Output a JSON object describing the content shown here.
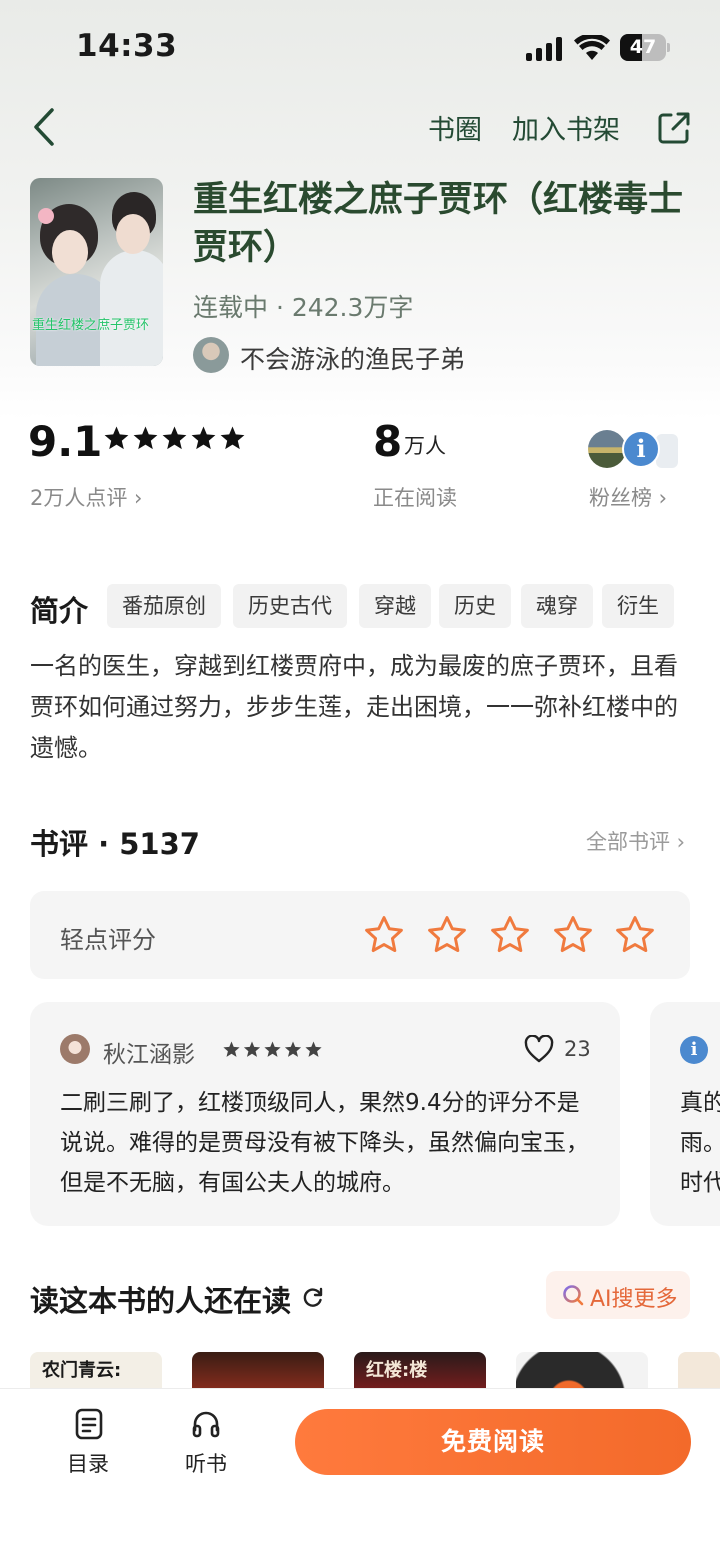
{
  "status_bar": {
    "time": "14:33",
    "battery": "47",
    "battery_level": 0.47
  },
  "nav": {
    "circle": "书圈",
    "add_shelf": "加入书架"
  },
  "book": {
    "title": "重生红楼之庶子贾环（红楼毒士贾环）",
    "meta": "连载中 · 242.3万字",
    "author": "不会游泳的渔民子弟",
    "cover_text": "重生红楼之庶子贾环"
  },
  "stats": {
    "score": "9.1",
    "rating_stars": 5,
    "score_sub": "2万人点评 ›",
    "readers_num": "8",
    "readers_unit": "万人",
    "readers_sub": "正在阅读",
    "fans_sub": "粉丝榜 ›"
  },
  "intro": {
    "heading": "简介",
    "tags": [
      "番茄原创",
      "历史古代",
      "穿越",
      "历史",
      "魂穿",
      "衍生"
    ],
    "text": "一名的医生，穿越到红楼贾府中，成为最废的庶子贾环，且看贾环如何通过努力，步步生莲，走出困境，一一弥补红楼中的遗憾。"
  },
  "reviews": {
    "heading": "书评 · 5137",
    "all_label": "全部书评 ›",
    "rate_label": "轻点评分",
    "items": [
      {
        "user": "秋江涵影",
        "stars": 5,
        "likes": "23",
        "text": "二刷三刷了，红楼顶级同人，果然9.4分的评分不是说说。难得的是贾母没有被下降头，虽然偏向宝玉，但是不无脑，有国公夫人的城府。"
      },
      {
        "text_lines": [
          "真的",
          "雨。",
          "时代"
        ]
      }
    ]
  },
  "also_reading": {
    "heading": "读这本书的人还在读",
    "ai_label": "AI搜更多",
    "covers": [
      "农门青云:",
      "",
      "红楼:楼",
      "",
      ""
    ]
  },
  "bottom_bar": {
    "catalog": "目录",
    "listen": "听书",
    "read": "免费阅读"
  },
  "colors": {
    "accent": "#f36a2a",
    "title_green": "#2a4a2f",
    "star_orange": "#f07a3e"
  }
}
